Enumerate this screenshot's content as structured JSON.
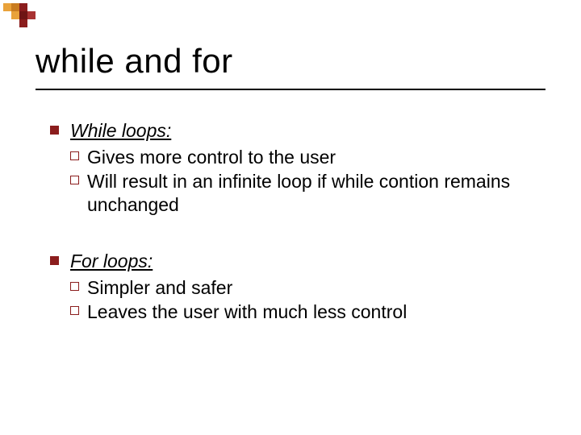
{
  "title": "while and for",
  "groups": [
    {
      "heading": "While loops:",
      "items": [
        "Gives more control to the user",
        "Will result in an infinite loop if while contion remains unchanged"
      ]
    },
    {
      "heading": "For loops:",
      "items": [
        "Simpler and safer",
        "Leaves the user with much less control"
      ]
    }
  ]
}
